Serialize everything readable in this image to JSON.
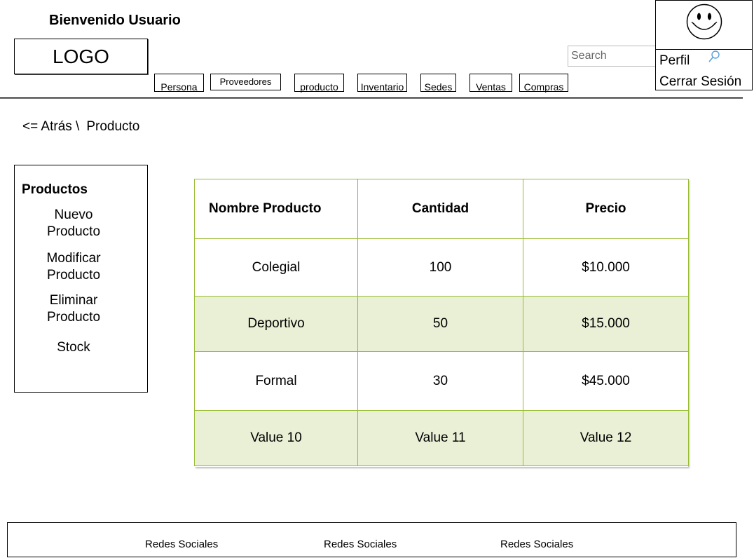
{
  "header": {
    "welcome": "Bienvenido Usuario",
    "logo": "LOGO"
  },
  "nav": {
    "tabs": [
      "Persona",
      "Proveedores",
      "producto",
      "Inventario",
      "Sedes",
      "Ventas",
      "Compras"
    ]
  },
  "search": {
    "placeholder": "Search"
  },
  "user_menu": {
    "profile": "Perfil",
    "logout": "Cerrar Sesión"
  },
  "breadcrumb": {
    "back": "<= Atrás \\",
    "current": "Producto"
  },
  "sidebar": {
    "title": "Productos",
    "items": [
      "Nuevo Producto",
      "Modificar Producto",
      "Eliminar Producto",
      "Stock"
    ]
  },
  "table": {
    "headers": [
      "Nombre Producto",
      "Cantidad",
      "Precio"
    ],
    "rows": [
      [
        "Colegial",
        "100",
        "$10.000"
      ],
      [
        "Deportivo",
        "50",
        "$15.000"
      ],
      [
        "Formal",
        "30",
        "$45.000"
      ],
      [
        "Value 10",
        "Value 11",
        "Value 12"
      ]
    ]
  },
  "footer": {
    "links": [
      "Redes Sociales",
      "Redes Sociales",
      "Redes Sociales"
    ]
  }
}
